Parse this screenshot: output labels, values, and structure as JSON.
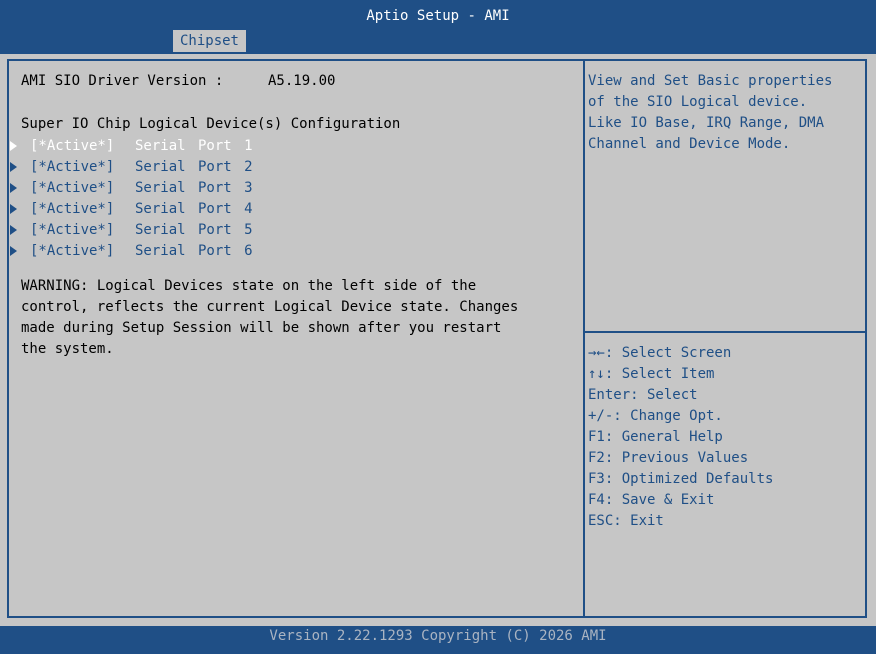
{
  "header": {
    "title": "Aptio Setup - AMI",
    "tabs": [
      "Chipset"
    ]
  },
  "main": {
    "driver_version_label": "AMI SIO Driver Version :",
    "driver_version_value": "A5.19.00",
    "section_heading": "Super IO Chip Logical Device(s) Configuration",
    "devices": [
      {
        "status": "[*Active*]",
        "name": "Serial Port 1"
      },
      {
        "status": "[*Active*]",
        "name": "Serial Port 2"
      },
      {
        "status": "[*Active*]",
        "name": "Serial Port 3"
      },
      {
        "status": "[*Active*]",
        "name": "Serial Port 4"
      },
      {
        "status": "[*Active*]",
        "name": "Serial Port 5"
      },
      {
        "status": "[*Active*]",
        "name": "Serial Port 6"
      }
    ],
    "selected_device_index": 0,
    "warning_lines": [
      "WARNING: Logical Devices state on the left side of the",
      "control, reflects the current Logical Device state. Changes",
      "made during Setup Session will be shown after you restart",
      "the system."
    ]
  },
  "help": {
    "lines": [
      "View and Set Basic properties",
      "of the SIO Logical device.",
      "Like IO Base, IRQ Range, DMA",
      "Channel and Device Mode."
    ]
  },
  "keys": [
    "→←: Select Screen",
    "↑↓: Select Item",
    "Enter: Select",
    "+/-: Change Opt.",
    "F1: General Help",
    "F2: Previous Values",
    "F3: Optimized Defaults",
    "F4: Save & Exit",
    "ESC: Exit"
  ],
  "footer": {
    "text": "Version 2.22.1293 Copyright (C) 2026 AMI"
  },
  "colors": {
    "accent": "#1f4f86",
    "panel": "#c6c6c6",
    "selected_text": "#ffffff"
  }
}
